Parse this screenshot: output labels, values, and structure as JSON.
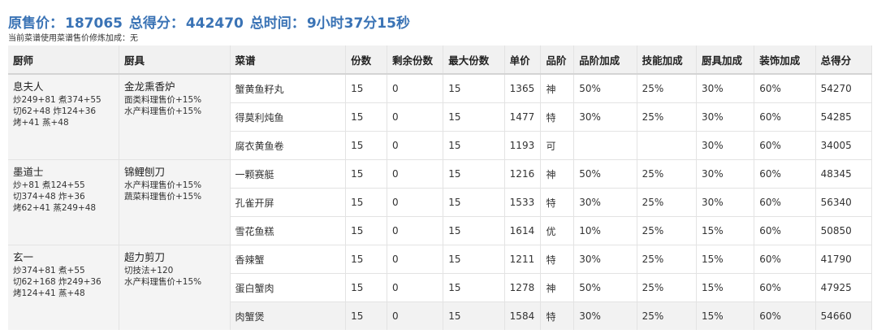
{
  "summary": {
    "price_label": "原售价：",
    "price_value": "187065",
    "score_label": "总得分：",
    "score_value": "442470",
    "time_label": "总时间：",
    "time_value": "9小时37分15秒"
  },
  "note": "当前菜谱使用菜谱售价修炼加成：无",
  "headers": [
    "厨师",
    "厨具",
    "菜谱",
    "份数",
    "剩余份数",
    "最大份数",
    "单价",
    "品阶",
    "品阶加成",
    "技能加成",
    "厨具加成",
    "装饰加成",
    "总得分"
  ],
  "groups": [
    {
      "chef": "息夫人",
      "chef_skills": [
        "炒249+81 煮374+55",
        "切62+48 炸124+36",
        "烤+41 蒸+48"
      ],
      "tool": "金龙熏香炉",
      "tool_bonuses": [
        "面类料理售价+15%",
        "水产料理售价+15%"
      ],
      "rows": [
        {
          "recipe": "蟹黄鱼籽丸",
          "qty": "15",
          "remain": "0",
          "max": "15",
          "price": "1365",
          "grade": "神",
          "grade_bonus": "50%",
          "skill_bonus": "25%",
          "tool_bonus": "30%",
          "deco_bonus": "60%",
          "total": "54270"
        },
        {
          "recipe": "得莫利炖鱼",
          "qty": "15",
          "remain": "0",
          "max": "15",
          "price": "1477",
          "grade": "特",
          "grade_bonus": "30%",
          "skill_bonus": "25%",
          "tool_bonus": "30%",
          "deco_bonus": "60%",
          "total": "54285"
        },
        {
          "recipe": "腐衣黄鱼卷",
          "qty": "15",
          "remain": "0",
          "max": "15",
          "price": "1193",
          "grade": "可",
          "grade_bonus": "",
          "skill_bonus": "",
          "tool_bonus": "30%",
          "deco_bonus": "60%",
          "total": "34005"
        }
      ]
    },
    {
      "chef": "墨道士",
      "chef_skills": [
        "炒+81 煮124+55",
        "切374+48 炸+36",
        "烤62+41 蒸249+48"
      ],
      "tool": "锦鲤刨刀",
      "tool_bonuses": [
        "水产料理售价+15%",
        "蔬菜料理售价+15%"
      ],
      "rows": [
        {
          "recipe": "一颗赛艇",
          "qty": "15",
          "remain": "0",
          "max": "15",
          "price": "1216",
          "grade": "神",
          "grade_bonus": "50%",
          "skill_bonus": "25%",
          "tool_bonus": "30%",
          "deco_bonus": "60%",
          "total": "48345"
        },
        {
          "recipe": "孔雀开屏",
          "qty": "15",
          "remain": "0",
          "max": "15",
          "price": "1533",
          "grade": "特",
          "grade_bonus": "30%",
          "skill_bonus": "25%",
          "tool_bonus": "30%",
          "deco_bonus": "60%",
          "total": "56340"
        },
        {
          "recipe": "雪花鱼糕",
          "qty": "15",
          "remain": "0",
          "max": "15",
          "price": "1614",
          "grade": "优",
          "grade_bonus": "10%",
          "skill_bonus": "25%",
          "tool_bonus": "15%",
          "deco_bonus": "60%",
          "total": "50850"
        }
      ]
    },
    {
      "chef": "玄一",
      "chef_skills": [
        "炒374+81 煮+55",
        "切62+168 炸249+36",
        "烤124+41 蒸+48"
      ],
      "tool": "超力剪刀",
      "tool_bonuses": [
        "切技法+120",
        "水产料理售价+15%"
      ],
      "rows": [
        {
          "recipe": "香辣蟹",
          "qty": "15",
          "remain": "0",
          "max": "15",
          "price": "1211",
          "grade": "特",
          "grade_bonus": "30%",
          "skill_bonus": "25%",
          "tool_bonus": "15%",
          "deco_bonus": "60%",
          "total": "41790"
        },
        {
          "recipe": "蛋白蟹肉",
          "qty": "15",
          "remain": "0",
          "max": "15",
          "price": "1278",
          "grade": "神",
          "grade_bonus": "50%",
          "skill_bonus": "25%",
          "tool_bonus": "15%",
          "deco_bonus": "60%",
          "total": "47925"
        },
        {
          "recipe": "肉蟹煲",
          "qty": "15",
          "remain": "0",
          "max": "15",
          "price": "1584",
          "grade": "特",
          "grade_bonus": "30%",
          "skill_bonus": "25%",
          "tool_bonus": "15%",
          "deco_bonus": "60%",
          "total": "54660",
          "highlight": true
        }
      ]
    }
  ]
}
